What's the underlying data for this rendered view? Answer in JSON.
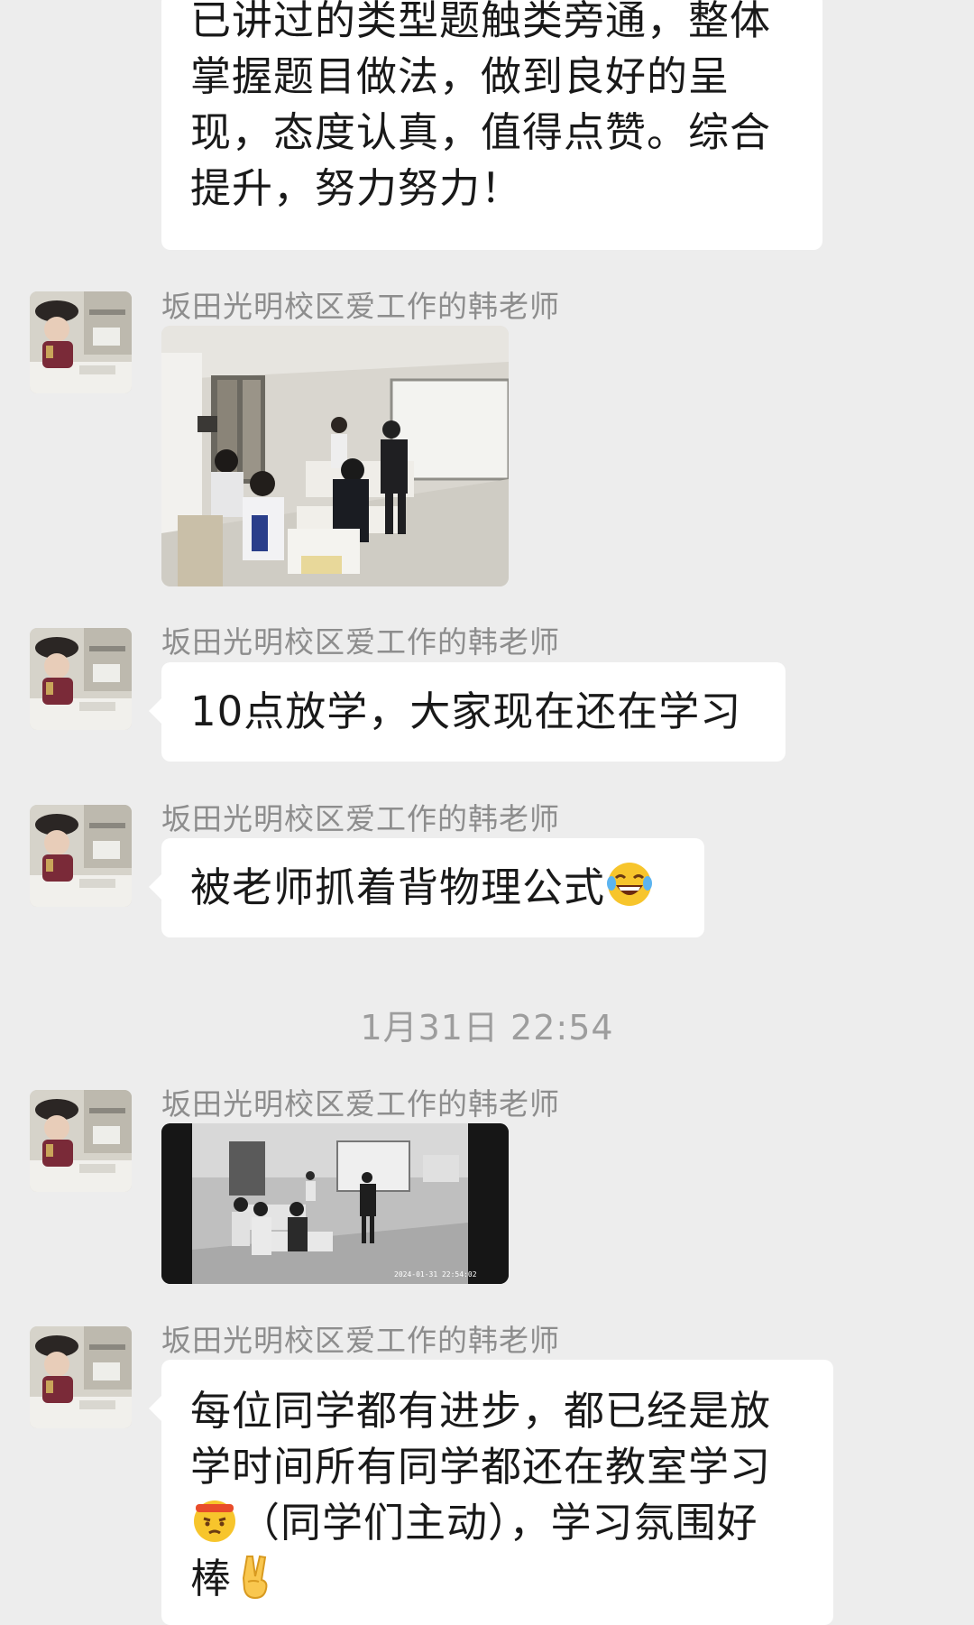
{
  "messages": [
    {
      "type": "text",
      "lines": [
        "已讲过的类型题触类旁通，整体",
        "掌握题目做法，做到良好的呈",
        "现，态度认真，值得点赞。综合",
        "提升，努力努力！"
      ]
    },
    {
      "type": "image",
      "sender": "坂田光明校区爱工作的韩老师",
      "image": "classroom-photo"
    },
    {
      "type": "text",
      "sender": "坂田光明校区爱工作的韩老师",
      "text": "10点放学，大家现在还在学习"
    },
    {
      "type": "text",
      "sender": "坂田光明校区爱工作的韩老师",
      "text": "被老师抓着背物理公式",
      "emoji": "laughing-tears-emoji"
    },
    {
      "type": "timestamp",
      "text": "1月31日 22:54"
    },
    {
      "type": "image",
      "sender": "坂田光明校区爱工作的韩老师",
      "image": "cctv-classroom-photo",
      "overlay": "2024-01-31 22:54:02"
    },
    {
      "type": "text",
      "sender": "坂田光明校区爱工作的韩老师",
      "lines": [
        "每位同学都有进步，都已经是放",
        "学时间所有同学都还在教室学习",
        "（同学们主动），学习氛围好",
        "棒"
      ],
      "emojis": [
        "determined-face-emoji",
        "victory-hand-emoji"
      ]
    }
  ],
  "colors": {
    "background": "#ededed",
    "bubble": "#ffffff",
    "sender": "#8d8d8d",
    "timestamp": "#9d9d9d"
  }
}
